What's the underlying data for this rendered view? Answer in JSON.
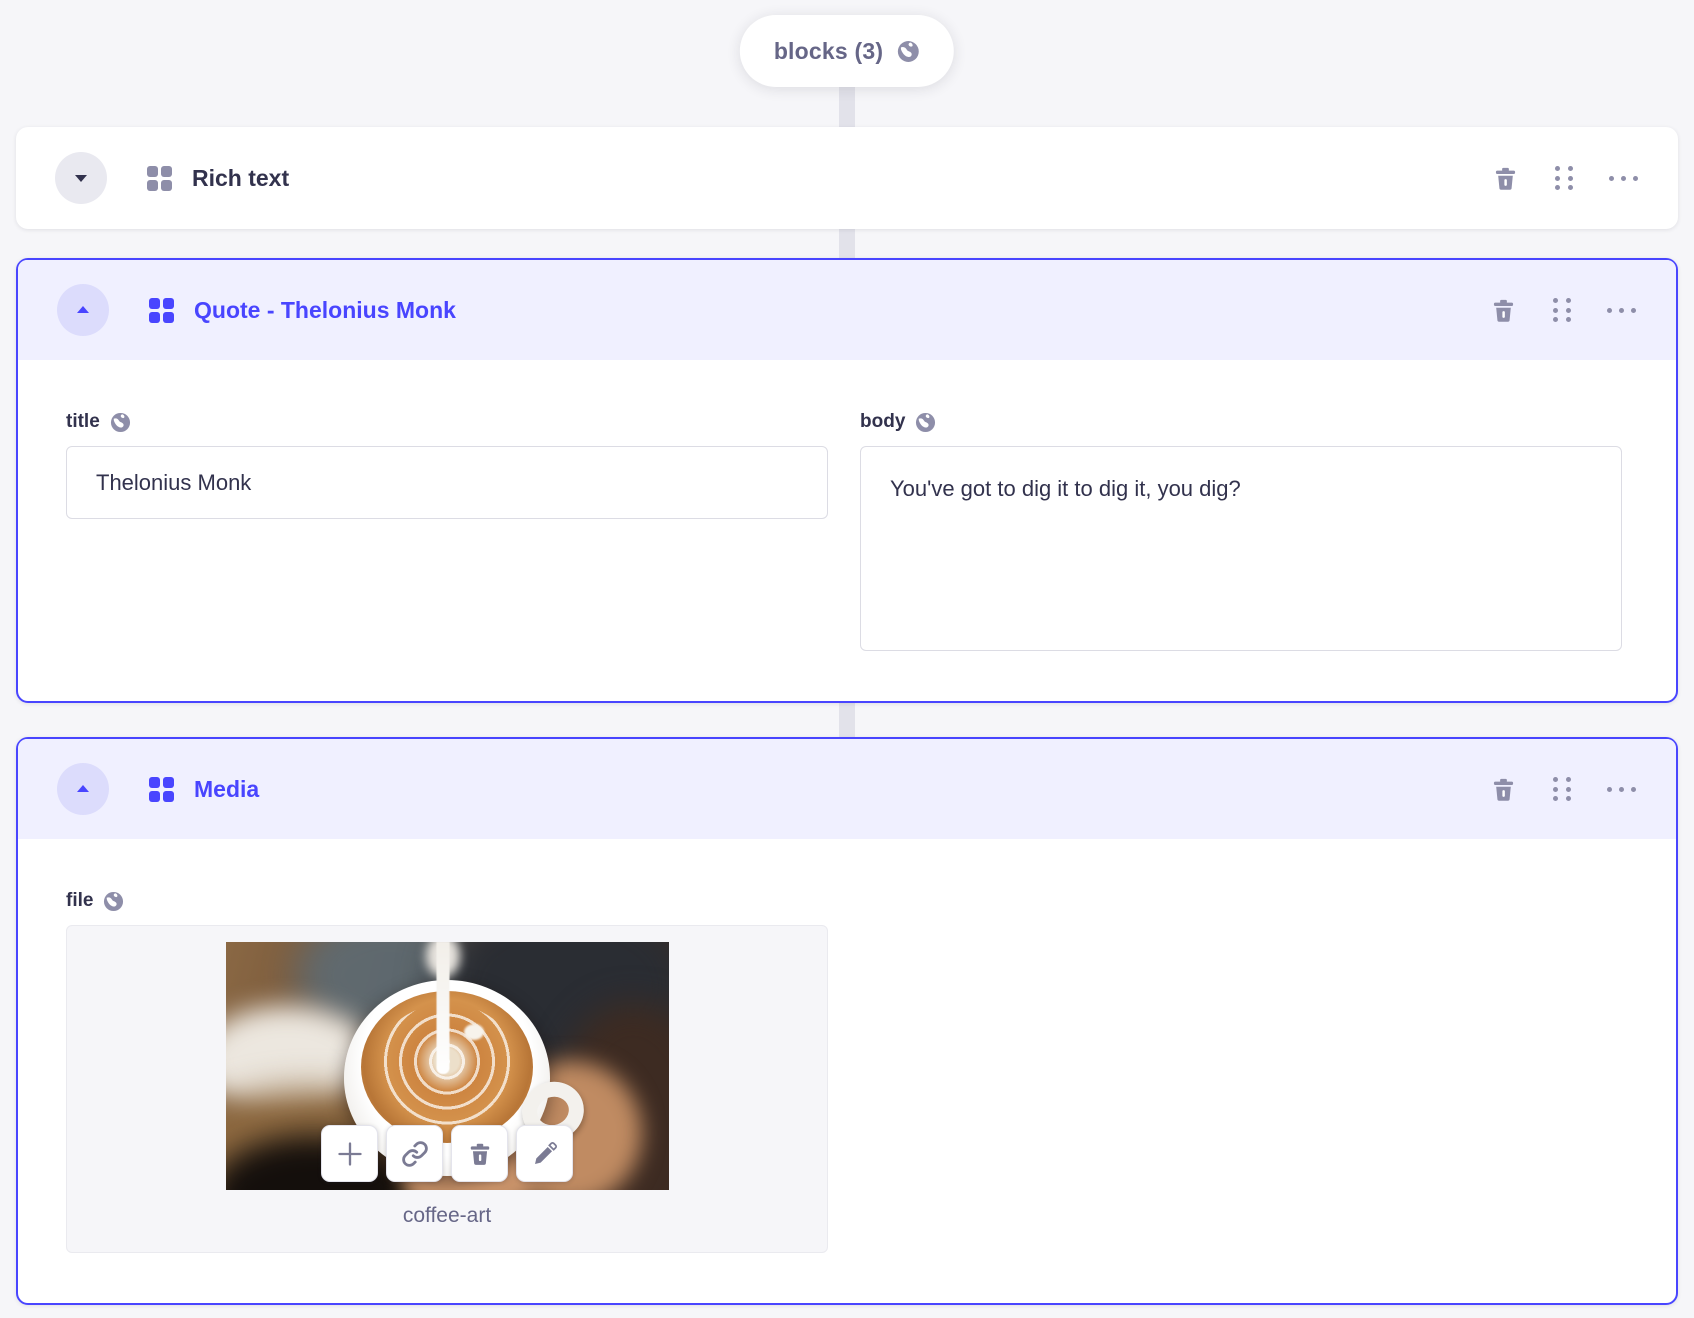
{
  "pill": {
    "label": "blocks (3)"
  },
  "blocks": [
    {
      "title": "Rich text",
      "state": "collapsed"
    },
    {
      "title": "Quote - Thelonius Monk",
      "state": "expanded",
      "fields": {
        "title": {
          "label": "title",
          "value": "Thelonius Monk"
        },
        "body": {
          "label": "body",
          "value": "You've got to dig it to dig it, you dig?"
        }
      }
    },
    {
      "title": "Media",
      "state": "expanded",
      "fields": {
        "file": {
          "label": "file",
          "file_name": "coffee-art"
        }
      }
    }
  ],
  "icons": {
    "globe": "globe-icon",
    "dynamic_zone": "blocks-grid-icon",
    "trash": "trash-icon",
    "drag": "drag-handle-icon",
    "more": "ellipsis-icon",
    "collapse_down": "chevron-down-icon",
    "collapse_up": "chevron-up-icon",
    "plus": "plus-icon",
    "link": "link-icon",
    "pencil": "pencil-icon"
  },
  "colors": {
    "primary": "#4945ff",
    "header_bg": "#f0f0ff",
    "text_dark": "#32324d",
    "text_muted": "#666687",
    "icon_gray": "#8e8ea9",
    "page_bg": "#f6f6f9"
  }
}
